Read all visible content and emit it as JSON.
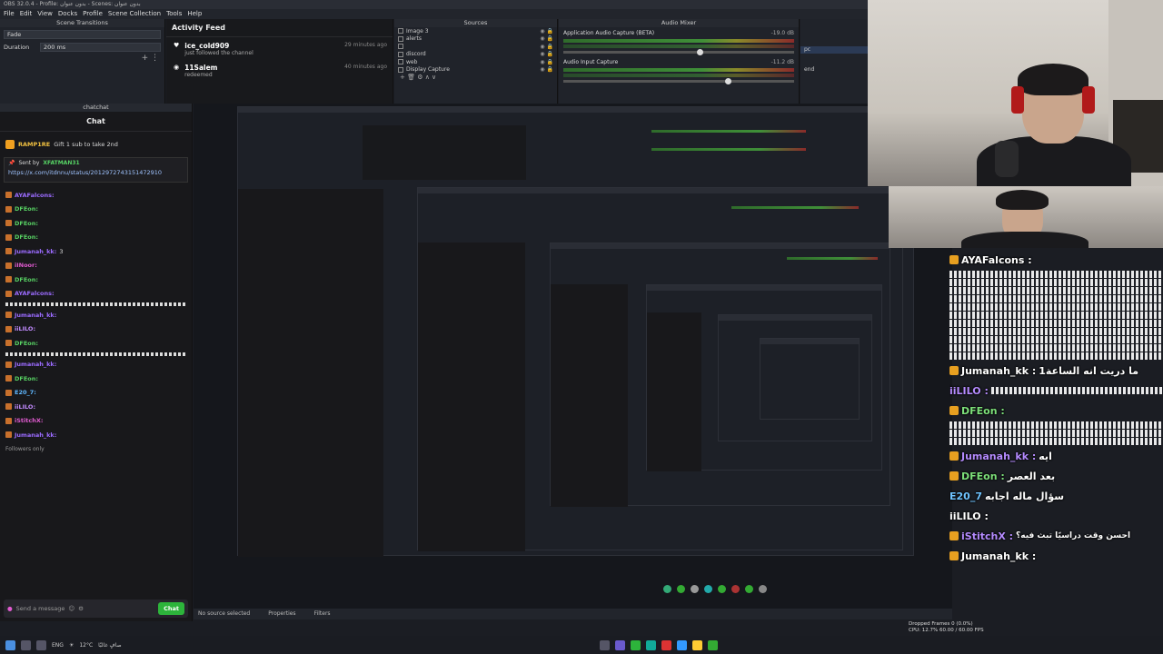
{
  "window": {
    "title": "OBS 32.0.4 - Profile: بدون عنوان - Scenes: بدون عنوان"
  },
  "menu": [
    "File",
    "Edit",
    "View",
    "Docks",
    "Profile",
    "Scene Collection",
    "Tools",
    "Help"
  ],
  "transitions": {
    "title": "Scene Transitions",
    "transition": "Fade",
    "duration_label": "Duration",
    "duration": "200 ms"
  },
  "activity": {
    "dock_title": "activity-fe",
    "header": "Activity Feed",
    "items": [
      {
        "user": "ice_cold909",
        "action": "just followed the channel",
        "time": "29 minutes ago"
      },
      {
        "user": "11Salem",
        "action": "redeemed",
        "time": "40 minutes ago"
      }
    ]
  },
  "sources": {
    "title": "Sources",
    "items": [
      "Image 3",
      "alerts",
      "",
      "discord",
      "web",
      "Display Capture"
    ]
  },
  "mixer": {
    "title": "Audio Mixer",
    "channels": [
      {
        "name": "Application Audio Capture (BETA)",
        "db": "-19.0 dB"
      },
      {
        "name": "Audio Input Capture",
        "db": "-11.2 dB"
      }
    ]
  },
  "scenes": {
    "items": [
      "pc",
      "end"
    ]
  },
  "chat": {
    "dock_title": "chatchat",
    "header": "Chat",
    "gift_user": "RAMP1RE",
    "gift_text": "Gift 1 sub to take 2nd",
    "pin_by": "Sent by",
    "pin_user": "XFATMAN31",
    "pin_link": "https://x.com/itdnnu/status/2012972743151472910",
    "messages": [
      {
        "user": "AYAFalcons:",
        "text": ""
      },
      {
        "user": "DFEon:",
        "text": ""
      },
      {
        "user": "DFEon:",
        "text": ""
      },
      {
        "user": "DFEon:",
        "text": ""
      },
      {
        "user": "Jumanah_kk:",
        "text": "3"
      },
      {
        "user": "iINoor:",
        "text": ""
      },
      {
        "user": "DFEon:",
        "text": ""
      },
      {
        "user": "AYAFalcons:",
        "text": ""
      },
      {
        "user": "Jumanah_kk:",
        "text": ""
      },
      {
        "user": "iiLILO:",
        "text": ""
      },
      {
        "user": "DFEon:",
        "text": ""
      },
      {
        "user": "Jumanah_kk:",
        "text": ""
      },
      {
        "user": "DFEon:",
        "text": ""
      },
      {
        "user": "E20_7:",
        "text": ""
      },
      {
        "user": "iiLILO:",
        "text": ""
      },
      {
        "user": "iStitchX:",
        "text": ""
      },
      {
        "user": "Jumanah_kk:",
        "text": ""
      }
    ],
    "followers_only": "Followers only",
    "placeholder": "Send a message",
    "send": "Chat"
  },
  "overlay": [
    {
      "user": "AYAFalcons :",
      "color": "white"
    },
    {
      "user": "Jumanah_kk :",
      "color": "white",
      "text": "ما دريت انه الساعة1"
    },
    {
      "user": "iiLILO :",
      "color": "purple"
    },
    {
      "user": "DFEon :",
      "color": "green"
    },
    {
      "user": "Jumanah_kk :",
      "color": "purple",
      "text": "ايه"
    },
    {
      "user": "DFEon :",
      "color": "green",
      "text": "بعد العصر"
    },
    {
      "user": "E20_7",
      "color": "blue",
      "text": "سؤال ماله اجابه"
    },
    {
      "user": "iiLILO :",
      "color": "white"
    },
    {
      "user": "iStitchX :",
      "color": "purple",
      "text": "احسن وقت دراسيًا تبث فيه؟"
    },
    {
      "user": "Jumanah_kk :",
      "color": "white"
    }
  ],
  "status": {
    "source": "No source selected",
    "properties": "Properties",
    "filters": "Filters"
  },
  "stats": {
    "line1": "Dropped Frames 0 (0.0%)",
    "line2": "CPU: 12.7%  60.00 / 60.00 FPS"
  },
  "taskbar": {
    "lang": "ENG",
    "weather": "12°C",
    "weather_text": "صافٍ غالبًا"
  }
}
